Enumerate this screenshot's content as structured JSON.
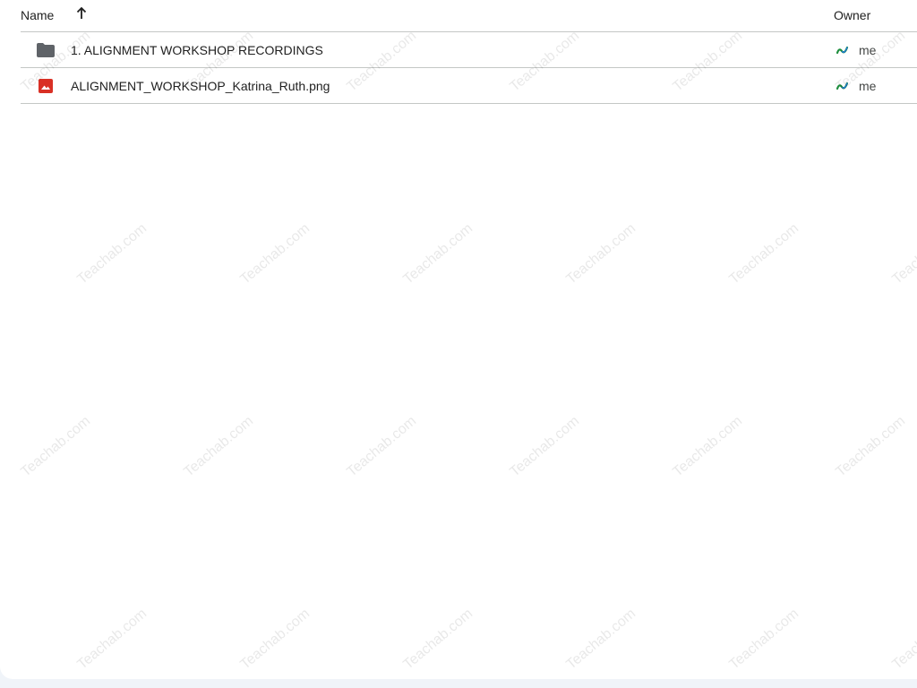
{
  "header": {
    "name_label": "Name",
    "owner_label": "Owner",
    "sort_icon": "arrow-up-icon"
  },
  "files": [
    {
      "type": "folder",
      "icon": "folder-icon",
      "name": "1. ALIGNMENT WORKSHOP RECORDINGS",
      "owner": "me"
    },
    {
      "type": "image",
      "icon": "image-file-icon",
      "name": "ALIGNMENT_WORKSHOP_Katrina_Ruth.png",
      "owner": "me"
    }
  ],
  "watermark": {
    "text": "Teachab.com"
  },
  "colors": {
    "folder": "#5f6368",
    "image_file": "#d93025",
    "avatar_green": "#1e8e3e",
    "avatar_blue": "#1a73e8",
    "background": "#f0f4f9"
  }
}
